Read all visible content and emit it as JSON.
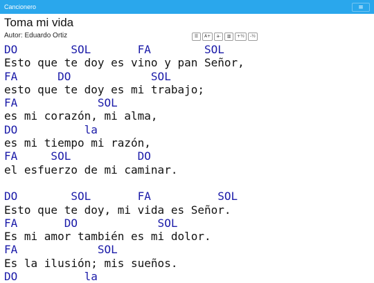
{
  "navbar": {
    "brand": "Cancionero",
    "menu_icon": "≡"
  },
  "song": {
    "title": "Toma mi vida",
    "author": "Autor: Eduardo Ortiz"
  },
  "toolbar": {
    "buttons": [
      {
        "name": "list-button",
        "label": "☰"
      },
      {
        "name": "font-increase-button",
        "label": "A+"
      },
      {
        "name": "font-decrease-button",
        "label": "a-"
      },
      {
        "name": "columns-button",
        "label": "▥"
      },
      {
        "name": "transpose-up-button",
        "label": "+½"
      },
      {
        "name": "transpose-down-button",
        "label": "-½"
      }
    ]
  },
  "colors": {
    "navbar": "#2aa7ec",
    "chord": "#1a1aa8",
    "text": "#111111"
  },
  "lyrics": [
    {
      "type": "chord",
      "text": "DO        SOL       FA        SOL"
    },
    {
      "type": "text",
      "text": "Esto que te doy es vino y pan Señor,"
    },
    {
      "type": "chord",
      "text": "FA      DO            SOL"
    },
    {
      "type": "text",
      "text": "esto que te doy es mi trabajo;"
    },
    {
      "type": "chord",
      "text": "FA            SOL"
    },
    {
      "type": "text",
      "text": "es mi corazón, mi alma,"
    },
    {
      "type": "chord",
      "text": "DO          la"
    },
    {
      "type": "text",
      "text": "es mi tiempo mi razón,"
    },
    {
      "type": "chord",
      "text": "FA     SOL          DO"
    },
    {
      "type": "text",
      "text": "el esfuerzo de mi caminar."
    },
    {
      "type": "blank",
      "text": ""
    },
    {
      "type": "chord",
      "text": "DO        SOL       FA          SOL"
    },
    {
      "type": "text",
      "text": "Esto que te doy, mi vida es Señor."
    },
    {
      "type": "chord",
      "text": "FA       DO            SOL"
    },
    {
      "type": "text",
      "text": "Es mi amor también es mi dolor."
    },
    {
      "type": "chord",
      "text": "FA            SOL"
    },
    {
      "type": "text",
      "text": "Es la ilusión; mis sueños."
    },
    {
      "type": "chord",
      "text": "DO          la"
    }
  ]
}
